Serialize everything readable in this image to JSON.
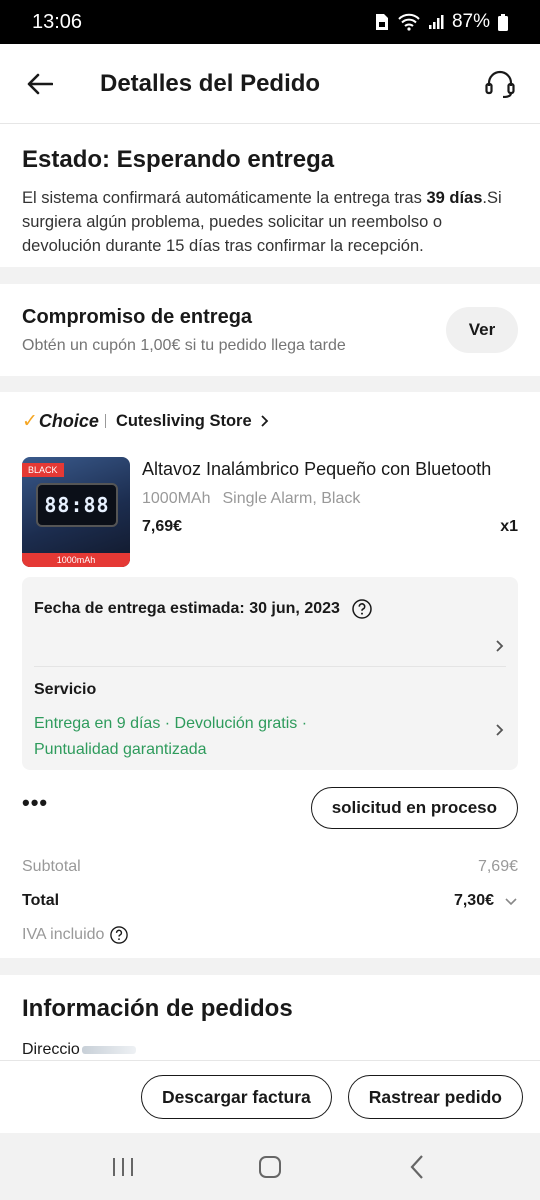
{
  "status_bar": {
    "time": "13:06",
    "battery": "87%"
  },
  "header": {
    "title": "Detalles del Pedido"
  },
  "status_card": {
    "title": "Estado: Esperando entrega",
    "desc_pre": "El sistema confirmará automáticamente la entrega tras ",
    "desc_bold": "39 días",
    "desc_post": ".Si surgiera algún problema, puedes solicitar un reembolso o devolución durante 15 días tras confirmar la recepción."
  },
  "commitment": {
    "title": "Compromiso de entrega",
    "subtitle": "Obtén un cupón 1,00€ si tu pedido llega tarde",
    "button": "Ver"
  },
  "order": {
    "choice_label": "Choice",
    "store_name": "Cutesliving Store",
    "product": {
      "image_badge": "BLACK",
      "image_clock": "88:88",
      "image_footer": "1000mAh",
      "title": "Altavoz Inalámbrico Pequeño con Bluetooth",
      "variant_capacity": "1000MAh",
      "variant_options": "Single Alarm, Black",
      "price": "7,69€",
      "quantity": "x1"
    },
    "delivery": {
      "estimated_label": "Fecha de entrega estimada: 30 jun, 2023",
      "service_title": "Servicio",
      "service_line1": "Entrega en 9 días · Devolución gratis ·",
      "service_line2": "Puntualidad garantizada"
    },
    "more_label": "•••",
    "request_button": "solicitud en proceso",
    "summary": {
      "subtotal_label": "Subtotal",
      "subtotal_value": "7,69€",
      "total_label": "Total",
      "total_value": "7,30€",
      "vat_label": "IVA incluido"
    }
  },
  "info": {
    "title": "Información de pedidos",
    "address_label": "Direccio"
  },
  "bottom": {
    "download_invoice": "Descargar factura",
    "track_order": "Rastrear pedido"
  }
}
